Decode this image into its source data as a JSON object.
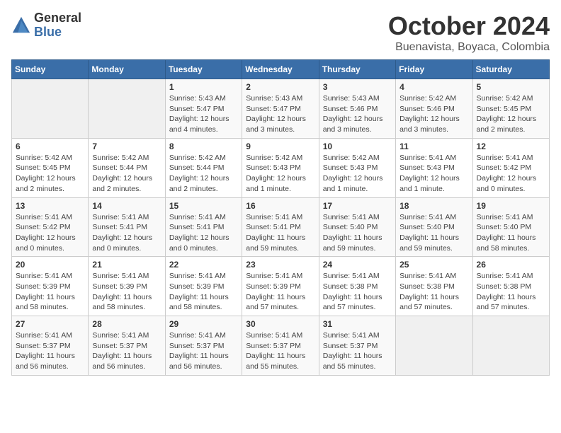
{
  "logo": {
    "general": "General",
    "blue": "Blue"
  },
  "title": {
    "month_year": "October 2024",
    "location": "Buenavista, Boyaca, Colombia"
  },
  "weekdays": [
    "Sunday",
    "Monday",
    "Tuesday",
    "Wednesday",
    "Thursday",
    "Friday",
    "Saturday"
  ],
  "weeks": [
    [
      {
        "day": "",
        "sunrise": "",
        "sunset": "",
        "daylight": ""
      },
      {
        "day": "",
        "sunrise": "",
        "sunset": "",
        "daylight": ""
      },
      {
        "day": "1",
        "sunrise": "Sunrise: 5:43 AM",
        "sunset": "Sunset: 5:47 PM",
        "daylight": "Daylight: 12 hours and 4 minutes."
      },
      {
        "day": "2",
        "sunrise": "Sunrise: 5:43 AM",
        "sunset": "Sunset: 5:47 PM",
        "daylight": "Daylight: 12 hours and 3 minutes."
      },
      {
        "day": "3",
        "sunrise": "Sunrise: 5:43 AM",
        "sunset": "Sunset: 5:46 PM",
        "daylight": "Daylight: 12 hours and 3 minutes."
      },
      {
        "day": "4",
        "sunrise": "Sunrise: 5:42 AM",
        "sunset": "Sunset: 5:46 PM",
        "daylight": "Daylight: 12 hours and 3 minutes."
      },
      {
        "day": "5",
        "sunrise": "Sunrise: 5:42 AM",
        "sunset": "Sunset: 5:45 PM",
        "daylight": "Daylight: 12 hours and 2 minutes."
      }
    ],
    [
      {
        "day": "6",
        "sunrise": "Sunrise: 5:42 AM",
        "sunset": "Sunset: 5:45 PM",
        "daylight": "Daylight: 12 hours and 2 minutes."
      },
      {
        "day": "7",
        "sunrise": "Sunrise: 5:42 AM",
        "sunset": "Sunset: 5:44 PM",
        "daylight": "Daylight: 12 hours and 2 minutes."
      },
      {
        "day": "8",
        "sunrise": "Sunrise: 5:42 AM",
        "sunset": "Sunset: 5:44 PM",
        "daylight": "Daylight: 12 hours and 2 minutes."
      },
      {
        "day": "9",
        "sunrise": "Sunrise: 5:42 AM",
        "sunset": "Sunset: 5:43 PM",
        "daylight": "Daylight: 12 hours and 1 minute."
      },
      {
        "day": "10",
        "sunrise": "Sunrise: 5:42 AM",
        "sunset": "Sunset: 5:43 PM",
        "daylight": "Daylight: 12 hours and 1 minute."
      },
      {
        "day": "11",
        "sunrise": "Sunrise: 5:41 AM",
        "sunset": "Sunset: 5:43 PM",
        "daylight": "Daylight: 12 hours and 1 minute."
      },
      {
        "day": "12",
        "sunrise": "Sunrise: 5:41 AM",
        "sunset": "Sunset: 5:42 PM",
        "daylight": "Daylight: 12 hours and 0 minutes."
      }
    ],
    [
      {
        "day": "13",
        "sunrise": "Sunrise: 5:41 AM",
        "sunset": "Sunset: 5:42 PM",
        "daylight": "Daylight: 12 hours and 0 minutes."
      },
      {
        "day": "14",
        "sunrise": "Sunrise: 5:41 AM",
        "sunset": "Sunset: 5:41 PM",
        "daylight": "Daylight: 12 hours and 0 minutes."
      },
      {
        "day": "15",
        "sunrise": "Sunrise: 5:41 AM",
        "sunset": "Sunset: 5:41 PM",
        "daylight": "Daylight: 12 hours and 0 minutes."
      },
      {
        "day": "16",
        "sunrise": "Sunrise: 5:41 AM",
        "sunset": "Sunset: 5:41 PM",
        "daylight": "Daylight: 11 hours and 59 minutes."
      },
      {
        "day": "17",
        "sunrise": "Sunrise: 5:41 AM",
        "sunset": "Sunset: 5:40 PM",
        "daylight": "Daylight: 11 hours and 59 minutes."
      },
      {
        "day": "18",
        "sunrise": "Sunrise: 5:41 AM",
        "sunset": "Sunset: 5:40 PM",
        "daylight": "Daylight: 11 hours and 59 minutes."
      },
      {
        "day": "19",
        "sunrise": "Sunrise: 5:41 AM",
        "sunset": "Sunset: 5:40 PM",
        "daylight": "Daylight: 11 hours and 58 minutes."
      }
    ],
    [
      {
        "day": "20",
        "sunrise": "Sunrise: 5:41 AM",
        "sunset": "Sunset: 5:39 PM",
        "daylight": "Daylight: 11 hours and 58 minutes."
      },
      {
        "day": "21",
        "sunrise": "Sunrise: 5:41 AM",
        "sunset": "Sunset: 5:39 PM",
        "daylight": "Daylight: 11 hours and 58 minutes."
      },
      {
        "day": "22",
        "sunrise": "Sunrise: 5:41 AM",
        "sunset": "Sunset: 5:39 PM",
        "daylight": "Daylight: 11 hours and 58 minutes."
      },
      {
        "day": "23",
        "sunrise": "Sunrise: 5:41 AM",
        "sunset": "Sunset: 5:39 PM",
        "daylight": "Daylight: 11 hours and 57 minutes."
      },
      {
        "day": "24",
        "sunrise": "Sunrise: 5:41 AM",
        "sunset": "Sunset: 5:38 PM",
        "daylight": "Daylight: 11 hours and 57 minutes."
      },
      {
        "day": "25",
        "sunrise": "Sunrise: 5:41 AM",
        "sunset": "Sunset: 5:38 PM",
        "daylight": "Daylight: 11 hours and 57 minutes."
      },
      {
        "day": "26",
        "sunrise": "Sunrise: 5:41 AM",
        "sunset": "Sunset: 5:38 PM",
        "daylight": "Daylight: 11 hours and 57 minutes."
      }
    ],
    [
      {
        "day": "27",
        "sunrise": "Sunrise: 5:41 AM",
        "sunset": "Sunset: 5:37 PM",
        "daylight": "Daylight: 11 hours and 56 minutes."
      },
      {
        "day": "28",
        "sunrise": "Sunrise: 5:41 AM",
        "sunset": "Sunset: 5:37 PM",
        "daylight": "Daylight: 11 hours and 56 minutes."
      },
      {
        "day": "29",
        "sunrise": "Sunrise: 5:41 AM",
        "sunset": "Sunset: 5:37 PM",
        "daylight": "Daylight: 11 hours and 56 minutes."
      },
      {
        "day": "30",
        "sunrise": "Sunrise: 5:41 AM",
        "sunset": "Sunset: 5:37 PM",
        "daylight": "Daylight: 11 hours and 55 minutes."
      },
      {
        "day": "31",
        "sunrise": "Sunrise: 5:41 AM",
        "sunset": "Sunset: 5:37 PM",
        "daylight": "Daylight: 11 hours and 55 minutes."
      },
      {
        "day": "",
        "sunrise": "",
        "sunset": "",
        "daylight": ""
      },
      {
        "day": "",
        "sunrise": "",
        "sunset": "",
        "daylight": ""
      }
    ]
  ]
}
